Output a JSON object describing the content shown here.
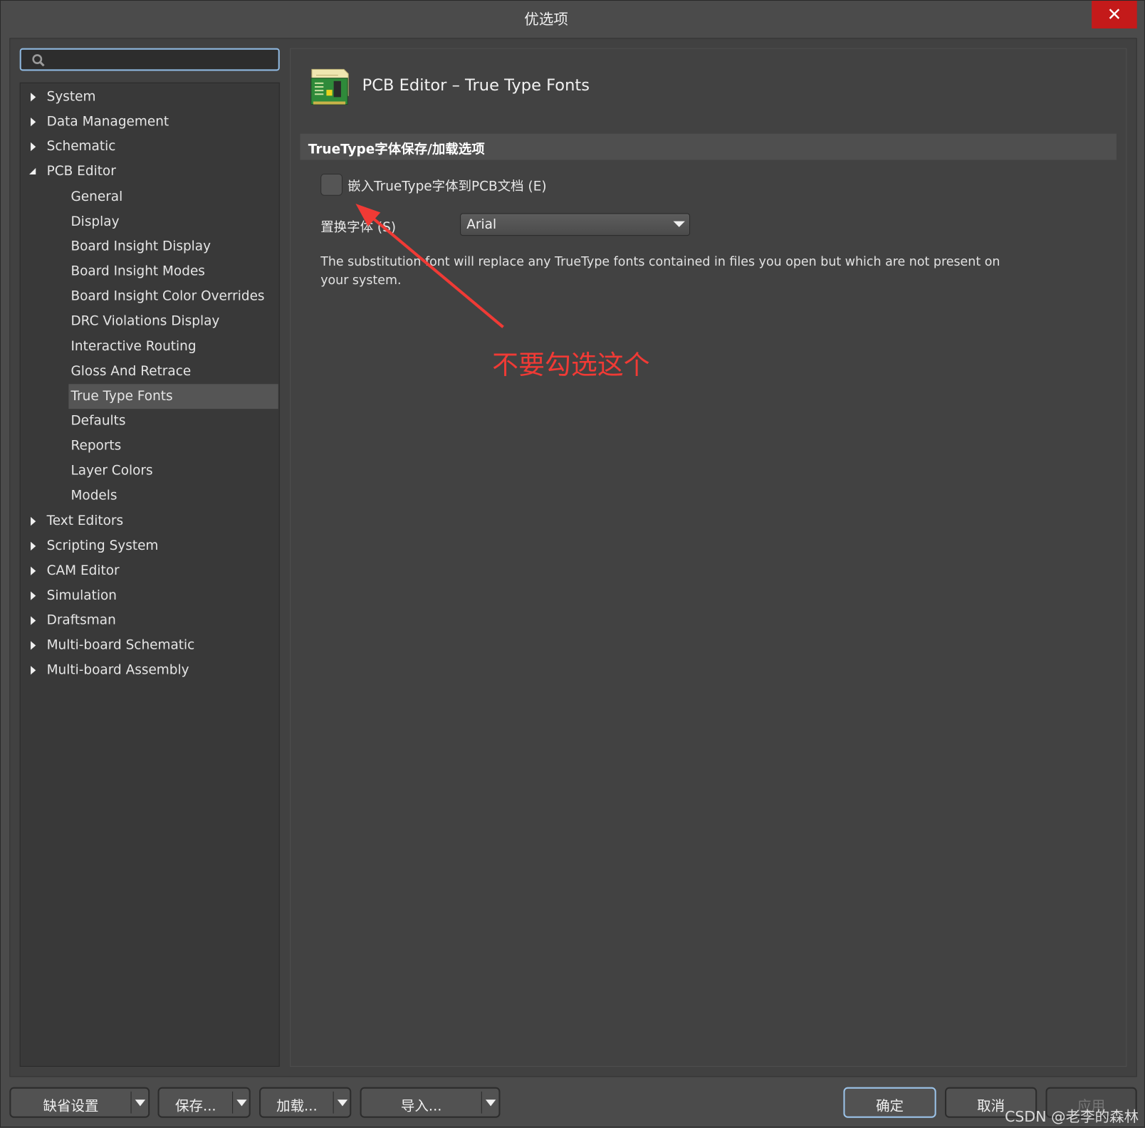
{
  "window": {
    "title": "优选项",
    "close_icon": "close-icon"
  },
  "search": {
    "placeholder": "",
    "value": ""
  },
  "tree": [
    {
      "label": "System",
      "level": 0,
      "expanded": false
    },
    {
      "label": "Data Management",
      "level": 0,
      "expanded": false
    },
    {
      "label": "Schematic",
      "level": 0,
      "expanded": false
    },
    {
      "label": "PCB Editor",
      "level": 0,
      "expanded": true
    },
    {
      "label": "General",
      "level": 1
    },
    {
      "label": "Display",
      "level": 1
    },
    {
      "label": "Board Insight Display",
      "level": 1
    },
    {
      "label": "Board Insight Modes",
      "level": 1
    },
    {
      "label": "Board Insight Color Overrides",
      "level": 1
    },
    {
      "label": "DRC Violations Display",
      "level": 1
    },
    {
      "label": "Interactive Routing",
      "level": 1
    },
    {
      "label": "Gloss And Retrace",
      "level": 1
    },
    {
      "label": "True Type Fonts",
      "level": 1,
      "selected": true
    },
    {
      "label": "Defaults",
      "level": 1
    },
    {
      "label": "Reports",
      "level": 1
    },
    {
      "label": "Layer Colors",
      "level": 1
    },
    {
      "label": "Models",
      "level": 1
    },
    {
      "label": "Text Editors",
      "level": 0,
      "expanded": false
    },
    {
      "label": "Scripting System",
      "level": 0,
      "expanded": false
    },
    {
      "label": "CAM Editor",
      "level": 0,
      "expanded": false
    },
    {
      "label": "Simulation",
      "level": 0,
      "expanded": false
    },
    {
      "label": "Draftsman",
      "level": 0,
      "expanded": false
    },
    {
      "label": "Multi-board Schematic",
      "level": 0,
      "expanded": false
    },
    {
      "label": "Multi-board Assembly",
      "level": 0,
      "expanded": false
    }
  ],
  "page": {
    "title": "PCB Editor – True Type Fonts",
    "section": "TrueType字体保存/加载选项",
    "embed_checkbox": {
      "label": "嵌入TrueType字体到PCB文档 (E)",
      "checked": false
    },
    "substitution": {
      "label": "置换字体 (S)",
      "value": "Arial"
    },
    "description": "The substitution font will replace any TrueType fonts contained in files you open but which are not present on your system."
  },
  "annotation": {
    "text": "不要勾选这个",
    "color": "#f03a35"
  },
  "buttons": {
    "defaults": "缺省设置",
    "save": "保存...",
    "load": "加载...",
    "import": "导入...",
    "ok": "确定",
    "cancel": "取消",
    "apply": "应用"
  },
  "watermark": "CSDN @老李的森林"
}
